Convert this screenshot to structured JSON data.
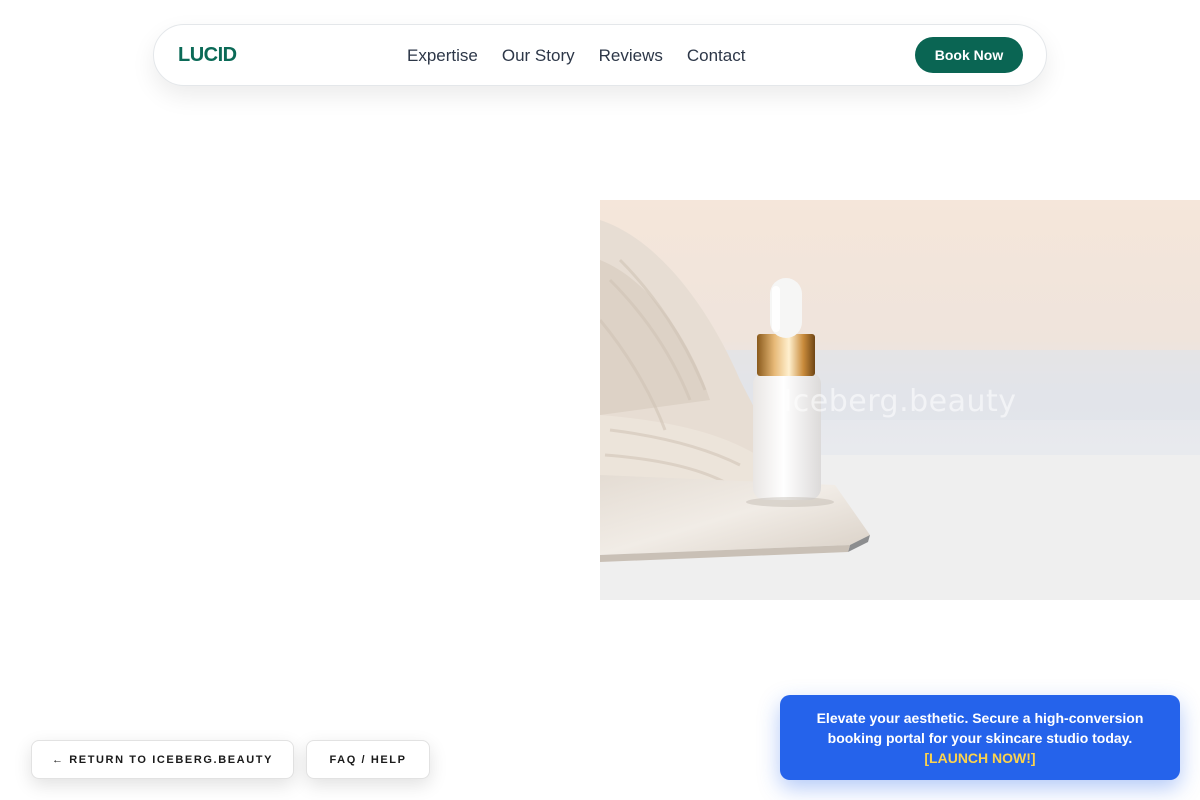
{
  "header": {
    "logo": "LUCID",
    "nav": [
      {
        "label": "Expertise"
      },
      {
        "label": "Our Story"
      },
      {
        "label": "Reviews"
      },
      {
        "label": "Contact"
      }
    ],
    "cta_label": "Book Now"
  },
  "hero": {
    "image_alt": "Skincare serum dropper bottle on a marble tray beside a knit blanket",
    "watermark": "Iceberg.beauty"
  },
  "footer_buttons": {
    "return_label": "← RETURN TO ICEBERG.BEAUTY",
    "faq_label": "FAQ / HELP"
  },
  "promo": {
    "text": "Elevate your aesthetic. Secure a high-conversion booking portal for your skincare studio today.",
    "cta": "[LAUNCH NOW!]"
  },
  "colors": {
    "brand": "#0a6553",
    "promo_bg": "#2563eb",
    "promo_cta": "#fcd34d"
  }
}
